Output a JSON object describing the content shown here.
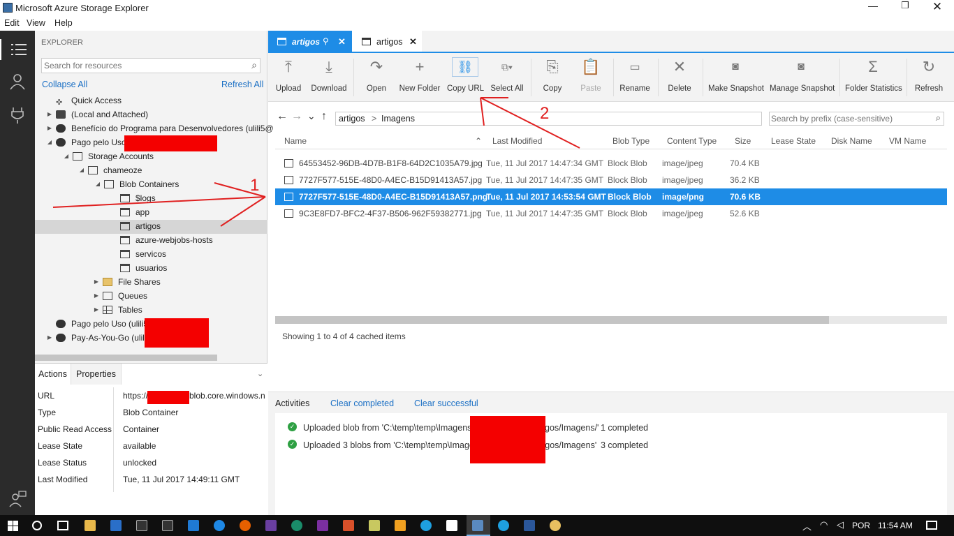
{
  "window": {
    "title": "Microsoft Azure Storage Explorer"
  },
  "menu": {
    "edit": "Edit",
    "view": "View",
    "help": "Help"
  },
  "explorer": {
    "header": "EXPLORER",
    "search_placeholder": "Search for resources",
    "collapse_all": "Collapse All",
    "refresh_all": "Refresh All"
  },
  "tree": {
    "quick_access": "Quick Access",
    "local": "(Local and Attached)",
    "beneficio": "Benefício do Programa para Desenvolvedores (ulili5@",
    "pago1": "Pago pelo Uso",
    "storage_accounts": "Storage Accounts",
    "chameoze": "chameoze",
    "blob_containers": "Blob Containers",
    "logs": "$logs",
    "app": "app",
    "artigos": "artigos",
    "webjobs": "azure-webjobs-hosts",
    "servicos": "servicos",
    "usuarios": "usuarios",
    "file_shares": "File Shares",
    "queues": "Queues",
    "tables": "Tables",
    "pago2": "Pago pelo Uso (ulili5",
    "payg": "Pay-As-You-Go (ulili5"
  },
  "props": {
    "tab_actions": "Actions",
    "tab_properties": "Properties",
    "rows": [
      {
        "label": "URL",
        "value": "https://"
      },
      {
        "label": "Type",
        "value": "Blob Container"
      },
      {
        "label": "Public Read Access",
        "value": "Container"
      },
      {
        "label": "Lease State",
        "value": "available"
      },
      {
        "label": "Lease Status",
        "value": "unlocked"
      },
      {
        "label": "Last Modified",
        "value": "Tue, 11 Jul 2017 14:49:11 GMT"
      }
    ],
    "url_suffix": "blob.core.windows.n"
  },
  "tabs": [
    {
      "label": "artigos"
    },
    {
      "label": "artigos"
    }
  ],
  "toolbar": {
    "upload": "Upload",
    "download": "Download",
    "open": "Open",
    "new_folder": "New Folder",
    "copy_url": "Copy URL",
    "select_all": "Select All",
    "copy": "Copy",
    "paste": "Paste",
    "rename": "Rename",
    "delete": "Delete",
    "make_snapshot": "Make Snapshot",
    "manage_snapshot": "Manage Snapshot",
    "folder_statistics": "Folder Statistics",
    "refresh": "Refresh"
  },
  "path": {
    "root": "artigos",
    "folder": "Imagens",
    "sep": ">",
    "search_placeholder": "Search by prefix (case-sensitive)"
  },
  "columns": {
    "name": "Name",
    "last_modified": "Last Modified",
    "blob_type": "Blob Type",
    "content_type": "Content Type",
    "size": "Size",
    "lease_state": "Lease State",
    "disk_name": "Disk Name",
    "vm_name": "VM Name"
  },
  "blobs": [
    {
      "name": "64553452-96DB-4D7B-B1F8-64D2C1035A79.jpg",
      "modified": "Tue, 11 Jul 2017 14:47:34 GMT",
      "type": "Block Blob",
      "content": "image/jpeg",
      "size": "70.4 KB"
    },
    {
      "name": "7727F577-515E-48D0-A4EC-B15D91413A57.jpg",
      "modified": "Tue, 11 Jul 2017 14:47:35 GMT",
      "type": "Block Blob",
      "content": "image/jpeg",
      "size": "36.2 KB"
    },
    {
      "name": "7727F577-515E-48D0-A4EC-B15D91413A57.png",
      "modified": "Tue, 11 Jul 2017 14:53:54 GMT",
      "type": "Block Blob",
      "content": "image/png",
      "size": "70.6 KB"
    },
    {
      "name": "9C3E8FD7-BFC2-4F37-B506-962F59382771.jpg",
      "modified": "Tue, 11 Jul 2017 14:47:35 GMT",
      "type": "Block Blob",
      "content": "image/jpeg",
      "size": "52.6 KB"
    }
  ],
  "status": "Showing 1 to 4 of 4 cached items",
  "activities": {
    "title": "Activities",
    "clear_completed": "Clear completed",
    "clear_successful": "Clear successful",
    "items": [
      {
        "text": "Uploaded blob from 'C:\\temp\\temp\\Imagens",
        "tail": "gos/Imagens/'",
        "status": "1 completed"
      },
      {
        "text": "Uploaded 3 blobs from 'C:\\temp\\temp\\Image",
        "tail": "tigos/Imagens'",
        "status": "3 completed"
      }
    ]
  },
  "annotations": {
    "one": "1",
    "two": "2"
  },
  "taskbar": {
    "lang": "POR",
    "time": "11:54 AM"
  },
  "colors": {
    "accent": "#1e8ce6",
    "sidebar": "#2b2b2b",
    "redact": "#f40000",
    "annotation": "#e02020"
  }
}
